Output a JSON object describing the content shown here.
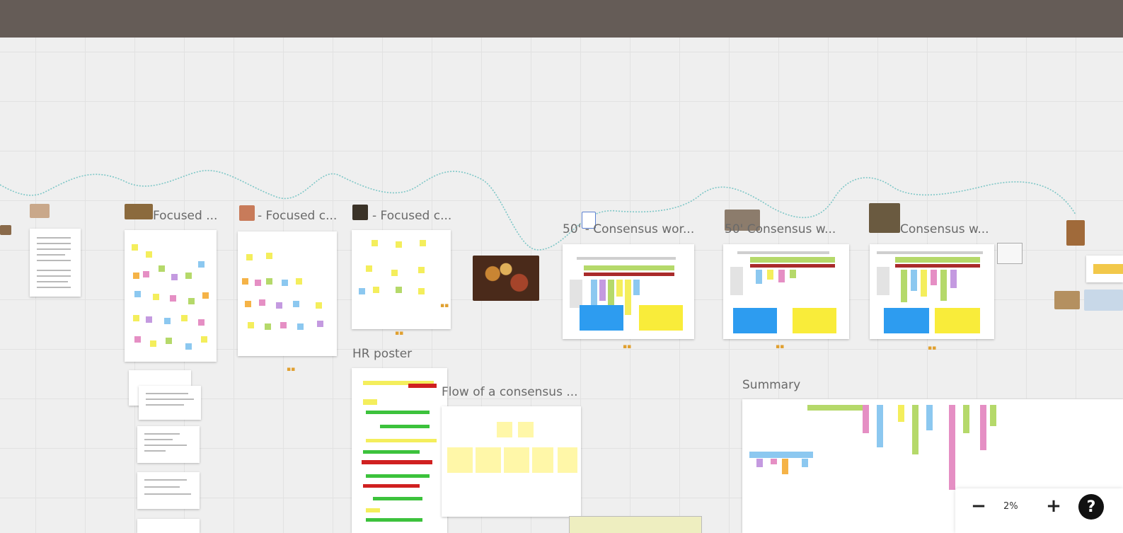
{
  "frames": {
    "focused1": "Focused ...",
    "focused2": "- Focused c...",
    "focused3": "- Focused c...",
    "consensus1": "50' - Consensus wor...",
    "consensus2": "50' Consensus w...",
    "consensus3": "Consensus w...",
    "hr": "HR poster",
    "flow": "Flow of a consensus ...",
    "summary": "Summary"
  },
  "zoom": {
    "minus": "−",
    "level": "2%",
    "plus": "+",
    "help": "?"
  },
  "icons": [
    "minus-icon",
    "plus-icon",
    "help-icon"
  ],
  "colors": {
    "topbar": "#655c57",
    "canvas": "#efefef",
    "sticky_yellow": "#f4ee5c",
    "sticky_green": "#b5d96a",
    "sticky_pink": "#e58fc4",
    "sticky_blue": "#8cc8f0",
    "sticky_purple": "#c49ae0",
    "sticky_orange": "#f5b347",
    "big_blue": "#2d9cf0",
    "big_yellow": "#f9ec3a"
  }
}
